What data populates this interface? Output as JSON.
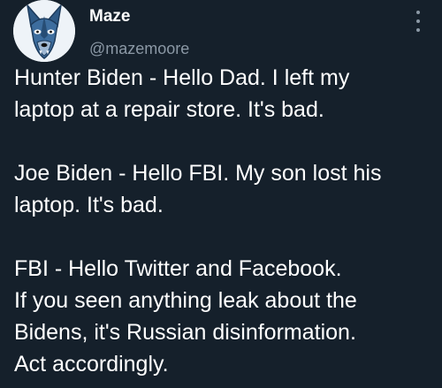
{
  "author": {
    "display_name": "Maze",
    "handle": "@mazemoore",
    "avatar_icon": "doberman-dog-icon"
  },
  "menu": {
    "icon": "more-vertical-icon"
  },
  "tweet": {
    "paragraphs": [
      {
        "lines": [
          "Hunter Biden - Hello Dad. I left my",
          "laptop at a repair store. It's bad."
        ]
      },
      {
        "lines": [
          "Joe Biden - Hello FBI. My son lost his",
          "laptop. It's bad."
        ]
      },
      {
        "lines": [
          "FBI - Hello Twitter and Facebook.",
          "If you seen anything leak about the",
          "Bidens, it's Russian disinformation.",
          "Act accordingly."
        ]
      }
    ]
  },
  "colors": {
    "background": "#15202b",
    "text": "#ffffff",
    "secondary_text": "#8b98a5"
  }
}
